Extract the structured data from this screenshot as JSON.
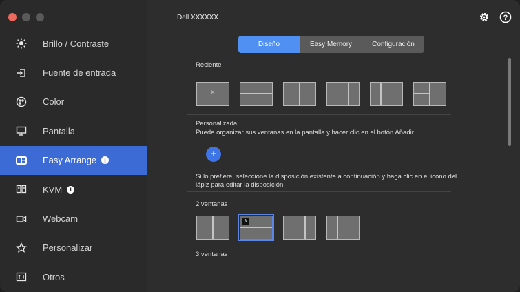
{
  "app": {
    "title": "Dell XXXXXX"
  },
  "sidebar": {
    "items": [
      {
        "label": "Brillo / Contraste",
        "icon": "brightness-icon"
      },
      {
        "label": "Fuente de entrada",
        "icon": "input-source-icon"
      },
      {
        "label": "Color",
        "icon": "color-palette-icon"
      },
      {
        "label": "Pantalla",
        "icon": "display-icon"
      },
      {
        "label": "Easy Arrange",
        "icon": "easy-arrange-icon",
        "active": true,
        "info": true
      },
      {
        "label": "KVM",
        "icon": "kvm-icon",
        "info": true
      },
      {
        "label": "Webcam",
        "icon": "webcam-icon"
      },
      {
        "label": "Personalizar",
        "icon": "star-icon"
      },
      {
        "label": "Otros",
        "icon": "others-icon"
      }
    ]
  },
  "tabs": [
    {
      "label": "Diseño",
      "active": true
    },
    {
      "label": "Easy Memory",
      "active": false
    },
    {
      "label": "Configuración",
      "active": false
    }
  ],
  "sections": {
    "recent": "Reciente",
    "custom_title": "Personalizada",
    "custom_desc": "Puede organizar sus ventanas en la pantalla y hacer clic en el botón Añadir.",
    "add_symbol": "+",
    "existing_desc_1": "Si lo prefiere, seleccione la disposición existente a continuación y haga clic en el icono del",
    "existing_desc_2": "lápiz para editar la disposición.",
    "two_windows": "2 ventanas",
    "three_windows": "3 ventanas"
  },
  "colors": {
    "accent": "#3d6bd6",
    "tab_active": "#4f90f2",
    "close": "#ec6a5e"
  }
}
